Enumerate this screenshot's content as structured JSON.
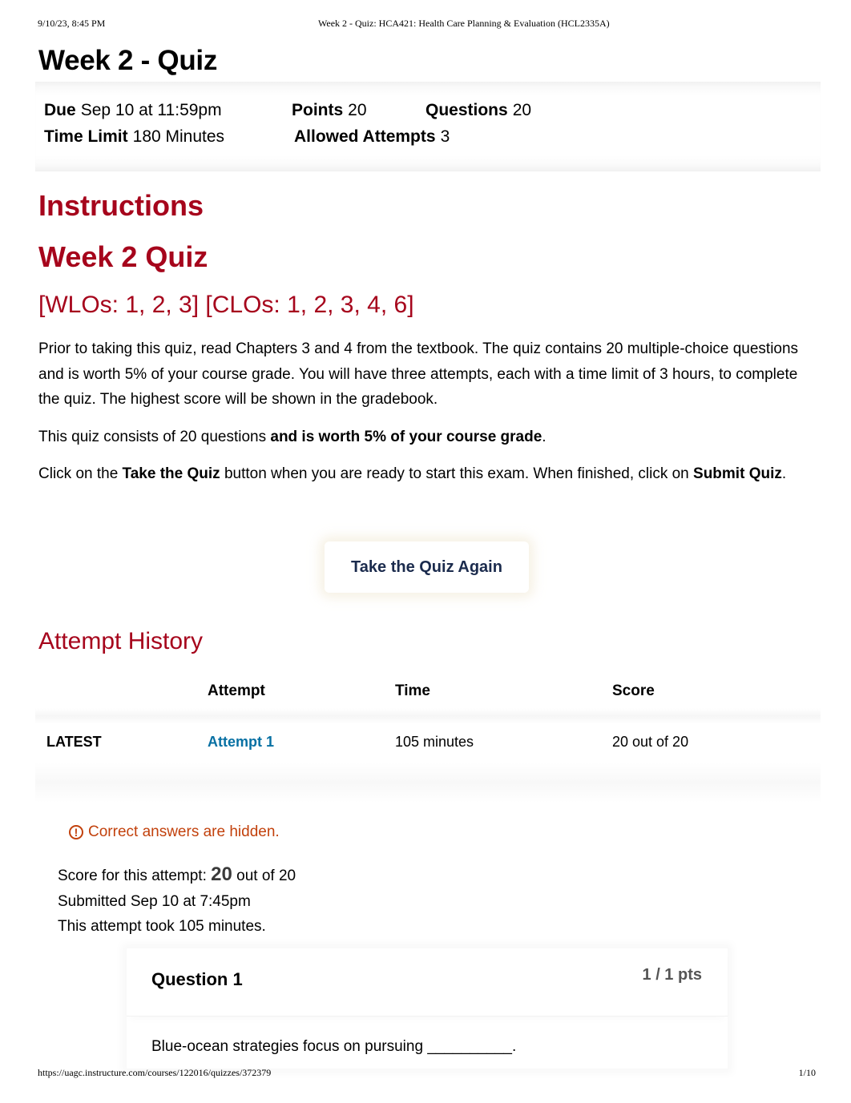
{
  "print_header": {
    "datetime": "9/10/23, 8:45 PM",
    "doc_title": "Week 2 - Quiz: HCA421: Health Care Planning & Evaluation (HCL2335A)"
  },
  "page_title": "Week 2 - Quiz",
  "quiz_meta": {
    "due_label": "Due",
    "due_value": "Sep 10 at 11:59pm",
    "points_label": "Points",
    "points_value": "20",
    "questions_label": "Questions",
    "questions_value": "20",
    "time_limit_label": "Time Limit",
    "time_limit_value": "180 Minutes",
    "allowed_attempts_label": "Allowed Attempts",
    "allowed_attempts_value": "3"
  },
  "instructions": {
    "heading": "Instructions",
    "subheading": "Week 2 Quiz",
    "outcomes": "[WLOs: 1, 2, 3] [CLOs: 1, 2, 3, 4, 6]",
    "paragraph1": "Prior to taking this quiz, read Chapters 3 and 4 from the textbook. The quiz contains 20 multiple-choice questions and is worth 5% of your course grade. You will have three attempts, each with a time limit of 3 hours, to complete the quiz. The highest score will be shown in the gradebook.",
    "paragraph2_prefix": "This quiz consists of 20 questions ",
    "paragraph2_bold": "and is worth 5% of your course grade",
    "paragraph2_suffix": ".",
    "paragraph3_prefix": "Click on the ",
    "paragraph3_bold1": "Take the Quiz",
    "paragraph3_mid": " button when you are ready to start this exam. When finished, click on ",
    "paragraph3_bold2": "Submit Quiz",
    "paragraph3_suffix": "."
  },
  "take_quiz_button": "Take the Quiz Again",
  "attempt_history": {
    "heading": "Attempt History",
    "columns": [
      "",
      "Attempt",
      "Time",
      "Score"
    ],
    "rows": [
      {
        "tag": "LATEST",
        "attempt": "Attempt 1",
        "time": "105 minutes",
        "score": "20 out of 20"
      }
    ]
  },
  "notice": {
    "icon": "warning-circle-icon",
    "text": "Correct answers are hidden."
  },
  "attempt_summary": {
    "score_prefix": "Score for this attempt:",
    "score_value": "20",
    "score_suffix": "out of 20",
    "submitted": "Submitted Sep 10 at 7:45pm",
    "duration": "This attempt took 105 minutes."
  },
  "question": {
    "title": "Question 1",
    "points": "1 / 1 pts",
    "text": "Blue-ocean strategies focus on pursuing __________."
  },
  "print_footer": {
    "url": "https://uagc.instructure.com/courses/122016/quizzes/372379",
    "page": "1/10"
  },
  "colors": {
    "heading_red": "#a6051c",
    "link_blue": "#0770a3",
    "notice_orange": "#c2410c",
    "button_text": "#1b2b4d"
  }
}
